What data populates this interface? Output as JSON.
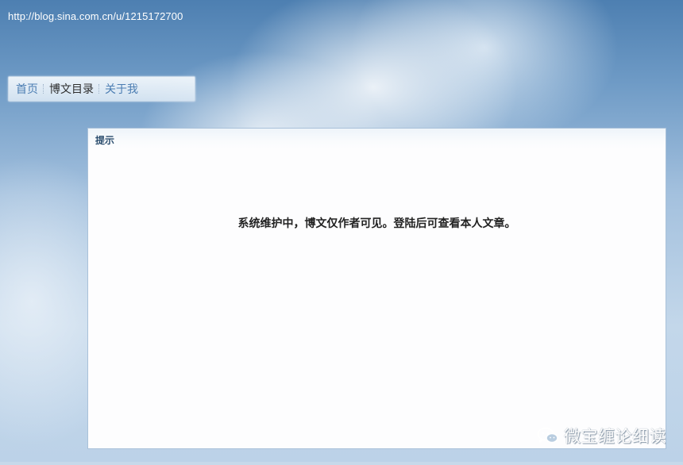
{
  "blog_url": "http://blog.sina.com.cn/u/1215172700",
  "nav": {
    "items": [
      {
        "label": "首页",
        "active": false
      },
      {
        "label": "博文目录",
        "active": true
      },
      {
        "label": "关于我",
        "active": false
      }
    ]
  },
  "notice": {
    "title": "提示",
    "message": "系统维护中，博文仅作者可见。登陆后可查看本人文章。"
  },
  "watermark": {
    "icon": "wechat-icon",
    "text": "微宝缠论细读"
  },
  "colors": {
    "nav_link": "#4b7db2",
    "nav_active": "#2d2d2d",
    "panel_border": "#a9c1d9",
    "notice_title": "#2b4d6e"
  }
}
